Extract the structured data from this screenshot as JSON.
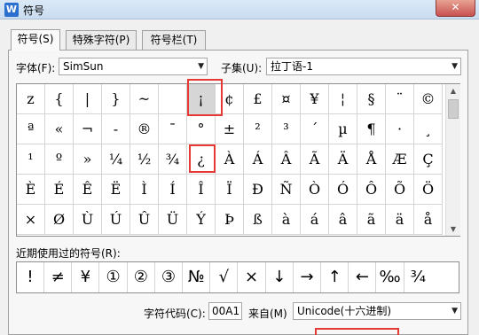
{
  "window": {
    "title": "符号",
    "app_icon_letter": "W",
    "close_glyph": "✕"
  },
  "tabs": [
    {
      "label": "符号(S)"
    },
    {
      "label": "特殊字符(P)"
    },
    {
      "label": "符号栏(T)"
    }
  ],
  "font": {
    "label": "字体(F):",
    "value": "SimSun"
  },
  "subset": {
    "label": "子集(U):",
    "value": "拉丁语-1"
  },
  "grid": {
    "rows": [
      [
        "z",
        "{",
        "|",
        "}",
        "~",
        "",
        "¡",
        "¢",
        "£",
        "¤",
        "¥",
        "¦",
        "§",
        "¨",
        "©"
      ],
      [
        "ª",
        "«",
        "¬",
        "-",
        "®",
        "¯",
        "°",
        "±",
        "²",
        "³",
        "´",
        "µ",
        "¶",
        "·",
        "¸"
      ],
      [
        "¹",
        "º",
        "»",
        "¼",
        "½",
        "¾",
        "¿",
        "À",
        "Á",
        "Â",
        "Ã",
        "Ä",
        "Å",
        "Æ",
        "Ç"
      ],
      [
        "È",
        "É",
        "Ê",
        "Ë",
        "Ì",
        "Í",
        "Î",
        "Ï",
        "Ð",
        "Ñ",
        "Ò",
        "Ó",
        "Ô",
        "Õ",
        "Ö"
      ],
      [
        "×",
        "Ø",
        "Ù",
        "Ú",
        "Û",
        "Ü",
        "Ý",
        "Þ",
        "ß",
        "à",
        "á",
        "â",
        "ã",
        "ä",
        "å"
      ]
    ],
    "selected": "¡"
  },
  "recent": {
    "label": "近期使用过的符号(R):",
    "symbols": [
      "!",
      "≠",
      "¥",
      "①",
      "②",
      "③",
      "№",
      "√",
      "×",
      "↓",
      "→",
      "↑",
      "←",
      "‰",
      "¾"
    ]
  },
  "char_code": {
    "label": "字符代码(C):",
    "value": "00A1"
  },
  "from": {
    "label": "来自(M)",
    "value": "Unicode(十六进制)"
  },
  "colors": {
    "highlight": "#e53935",
    "selected_bg": "#d6d6d6"
  },
  "icons": {
    "dropdown": "chevron-down-icon",
    "close": "close-icon"
  }
}
